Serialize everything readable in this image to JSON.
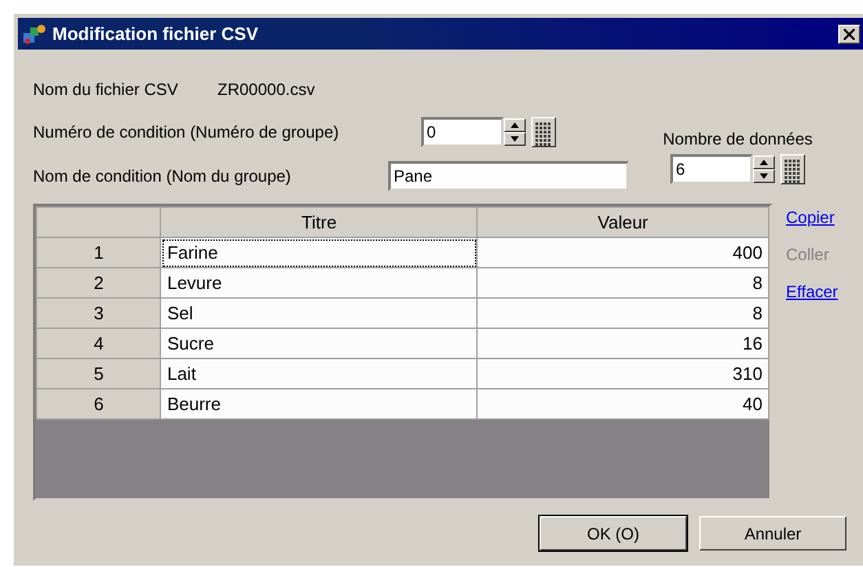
{
  "window": {
    "title": "Modification fichier CSV"
  },
  "file": {
    "label": "Nom du fichier CSV",
    "value": "ZR00000.csv"
  },
  "condition_number": {
    "label": "Numéro de condition (Numéro de groupe)",
    "value": "0"
  },
  "condition_name": {
    "label": "Nom de condition (Nom du groupe)",
    "value": "Pane"
  },
  "data_count": {
    "label": "Nombre de données",
    "value": "6"
  },
  "table": {
    "columns": [
      "Titre",
      "Valeur"
    ],
    "rows": [
      {
        "index": "1",
        "title": "Farine",
        "value": "400",
        "focused": true
      },
      {
        "index": "2",
        "title": "Levure",
        "value": "8",
        "focused": false
      },
      {
        "index": "3",
        "title": "Sel",
        "value": "8",
        "focused": false
      },
      {
        "index": "4",
        "title": "Sucre",
        "value": "16",
        "focused": false
      },
      {
        "index": "5",
        "title": "Lait",
        "value": "310",
        "focused": false
      },
      {
        "index": "6",
        "title": "Beurre",
        "value": "40",
        "focused": false
      }
    ]
  },
  "actions": [
    {
      "label": "Copier",
      "disabled": false
    },
    {
      "label": "Coller",
      "disabled": true
    },
    {
      "label": "Effacer",
      "disabled": false
    }
  ],
  "buttons": [
    {
      "label": "OK (O)",
      "default": true
    },
    {
      "label": "Annuler",
      "default": false
    }
  ]
}
